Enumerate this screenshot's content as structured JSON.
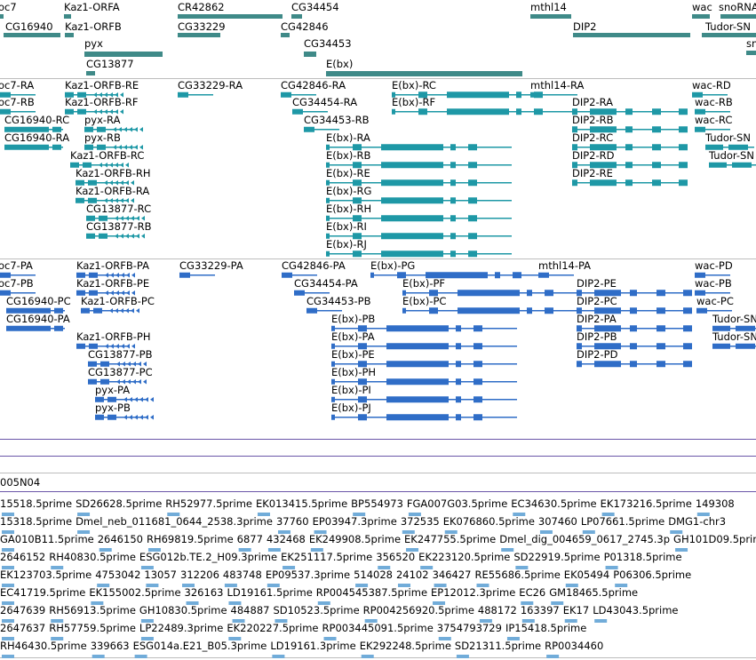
{
  "colors": {
    "rna": "#1e98a6",
    "cds": "#2f6dc7",
    "ncrna": "#3f8a88",
    "est": "#71acd9"
  },
  "bac": {
    "label": "005N04"
  },
  "gene_track": [
    {
      "label": "oc7",
      "line": "",
      "color": "ncrna"
    },
    {
      "label": "Kaz1-ORFA",
      "line": "",
      "color": "ncrna"
    },
    {
      "label": "CR42862",
      "line": "",
      "color": "ncrna"
    },
    {
      "label": "CG34454",
      "line": "",
      "color": "ncrna"
    },
    {
      "label": "mthl14",
      "line": "",
      "color": "ncrna"
    },
    {
      "label": "wac",
      "line": "",
      "color": "ncrna"
    },
    {
      "label": "snoRNA",
      "line": "",
      "color": "ncrna"
    },
    {
      "label": "CG16940",
      "line": "",
      "color": "ncrna"
    },
    {
      "label": "Kaz1-ORFB",
      "line": "",
      "color": "ncrna"
    },
    {
      "label": "CG33229",
      "line": "",
      "color": "ncrna"
    },
    {
      "label": "CG42846",
      "line": "",
      "color": "ncrna"
    },
    {
      "label": "DIP2",
      "line": "",
      "color": "ncrna"
    },
    {
      "label": "Tudor-SN",
      "line": "",
      "color": "ncrna"
    },
    {
      "label": "pyx",
      "line": "",
      "color": "ncrna"
    },
    {
      "label": "CG34453",
      "line": "",
      "color": "ncrna"
    },
    {
      "label": "sn",
      "line": "",
      "color": "ncrna"
    },
    {
      "label": "CG13877",
      "line": "",
      "color": "ncrna"
    },
    {
      "label": "E(bx)",
      "line": "",
      "color": "ncrna"
    }
  ],
  "transcript_track": [
    {
      "label": "oc7-RA",
      "color": "rna"
    },
    {
      "label": "Kaz1-ORFB-RE",
      "color": "rna"
    },
    {
      "label": "CG33229-RA",
      "color": "rna"
    },
    {
      "label": "CG42846-RA",
      "color": "rna"
    },
    {
      "label": "E(bx)-RC",
      "color": "rna"
    },
    {
      "label": "mthl14-RA",
      "color": "rna"
    },
    {
      "label": "wac-RD",
      "color": "rna"
    },
    {
      "label": "oc7-RB",
      "color": "rna"
    },
    {
      "label": "Kaz1-ORFB-RF",
      "color": "rna"
    },
    {
      "label": "CG34454-RA",
      "color": "rna"
    },
    {
      "label": "E(bx)-RF",
      "color": "rna"
    },
    {
      "label": "DIP2-RA",
      "color": "rna"
    },
    {
      "label": "wac-RB",
      "color": "rna"
    },
    {
      "label": "CG16940-RC",
      "color": "rna"
    },
    {
      "label": "pyx-RA",
      "color": "rna"
    },
    {
      "label": "CG34453-RB",
      "color": "rna"
    },
    {
      "label": "DIP2-RB",
      "color": "rna"
    },
    {
      "label": "wac-RC",
      "color": "rna"
    },
    {
      "label": "CG16940-RA",
      "color": "rna"
    },
    {
      "label": "pyx-RB",
      "color": "rna"
    },
    {
      "label": "E(bx)-RA",
      "color": "rna"
    },
    {
      "label": "DIP2-RC",
      "color": "rna"
    },
    {
      "label": "Tudor-SN",
      "color": "rna"
    },
    {
      "label": "Kaz1-ORFB-RC",
      "color": "rna"
    },
    {
      "label": "E(bx)-RB",
      "color": "rna"
    },
    {
      "label": "DIP2-RD",
      "color": "rna"
    },
    {
      "label": "Tudor-SN",
      "color": "rna"
    },
    {
      "label": "Kaz1-ORFB-RH",
      "color": "rna"
    },
    {
      "label": "E(bx)-RE",
      "color": "rna"
    },
    {
      "label": "DIP2-RE",
      "color": "rna"
    },
    {
      "label": "Kaz1-ORFB-RA",
      "color": "rna"
    },
    {
      "label": "E(bx)-RG",
      "color": "rna"
    },
    {
      "label": "CG13877-RC",
      "color": "rna"
    },
    {
      "label": "E(bx)-RH",
      "color": "rna"
    },
    {
      "label": "CG13877-RB",
      "color": "rna"
    },
    {
      "label": "E(bx)-RI",
      "color": "rna"
    },
    {
      "label": "E(bx)-RJ",
      "color": "rna"
    }
  ],
  "protein_track": [
    {
      "label": "oc7-PA",
      "color": "cds"
    },
    {
      "label": "Kaz1-ORFB-PA",
      "color": "cds"
    },
    {
      "label": "CG33229-PA",
      "color": "cds"
    },
    {
      "label": "CG42846-PA",
      "color": "cds"
    },
    {
      "label": "E(bx)-PG",
      "color": "cds"
    },
    {
      "label": "mthl14-PA",
      "color": "cds"
    },
    {
      "label": "wac-PD",
      "color": "cds"
    },
    {
      "label": "oc7-PB",
      "color": "cds"
    },
    {
      "label": "Kaz1-ORFB-PE",
      "color": "cds"
    },
    {
      "label": "CG34454-PA",
      "color": "cds"
    },
    {
      "label": "E(bx)-PF",
      "color": "cds"
    },
    {
      "label": "DIP2-PE",
      "color": "cds"
    },
    {
      "label": "wac-PB",
      "color": "cds"
    },
    {
      "label": "CG16940-PC",
      "color": "cds"
    },
    {
      "label": "Kaz1-ORFB-PC",
      "color": "cds"
    },
    {
      "label": "CG34453-PB",
      "color": "cds"
    },
    {
      "label": "E(bx)-PC",
      "color": "cds"
    },
    {
      "label": "DIP2-PC",
      "color": "cds"
    },
    {
      "label": "wac-PC",
      "color": "cds"
    },
    {
      "label": "CG16940-PA",
      "color": "cds"
    },
    {
      "label": "E(bx)-PB",
      "color": "cds"
    },
    {
      "label": "DIP2-PA",
      "color": "cds"
    },
    {
      "label": "Tudor-SN",
      "color": "cds"
    },
    {
      "label": "Kaz1-ORFB-PH",
      "color": "cds"
    },
    {
      "label": "E(bx)-PA",
      "color": "cds"
    },
    {
      "label": "DIP2-PB",
      "color": "cds"
    },
    {
      "label": "Tudor-SN",
      "color": "cds"
    },
    {
      "label": "CG13877-PB",
      "color": "cds"
    },
    {
      "label": "E(bx)-PE",
      "color": "cds"
    },
    {
      "label": "DIP2-PD",
      "color": "cds"
    },
    {
      "label": "CG13877-PC",
      "color": "cds"
    },
    {
      "label": "E(bx)-PH",
      "color": "cds"
    },
    {
      "label": "pyx-PA",
      "color": "cds"
    },
    {
      "label": "E(bx)-PI",
      "color": "cds"
    },
    {
      "label": "pyx-PB",
      "color": "cds"
    },
    {
      "label": "E(bx)-PJ",
      "color": "cds"
    }
  ],
  "est_labels": [
    "15518.5prime",
    "SD26628.5prime",
    "RH52977.5prime",
    "EK013415.5prime",
    "BP554973",
    "FGA007G03.5prime",
    "EC34630.5prime",
    "EK173216.5prime",
    "149308",
    "15318.5prime",
    "Dmel_neb_011681_0644_2538.3prime",
    "37760",
    "EP03947.3prime",
    "372535",
    "EK076860.5prime",
    "307460",
    "LP07661.5prime",
    "DMG1-chr3",
    "GA010B11.5prime",
    "2646150",
    "RH69819.5prime",
    "6877",
    "432468",
    "EK249908.5prime",
    "EK247755.5prime",
    "Dmel_dig_004659_0617_2745.3p",
    "GH101D09.5prime",
    "2646152",
    "RH40830.5prime",
    "ESG012b.TE.2_H09.3prime",
    "EK251117.5prime",
    "356520",
    "EK223120.5prime",
    "SD22919.5prime",
    "P01318.5prime",
    "EK123703.5prime",
    "4753042",
    "13057",
    "312206",
    "483748",
    "EP09537.3prime",
    "514028",
    "24102",
    "346427",
    "RE55686.5prime",
    "EK05494",
    "P06306.5prime",
    "EC41719.5prime",
    "EK155002.5prime",
    "326163",
    "LD19161.5prime",
    "RP004545387.5prime",
    "EP12012.3prime",
    "EC26",
    "GM18465.5prime",
    "2647639",
    "RH56913.5prime",
    "GH10830.5prime",
    "484887",
    "SD10523.5prime",
    "RP004256920.5prime",
    "488172",
    "163397",
    "EK17",
    "LD43043.5prime",
    "2647637",
    "RH57759.5prime",
    "LP22489.3prime",
    "EK220227.5prime",
    "RP003445091.5prime",
    "3754793729",
    "IP15418.5prime",
    "RH46430.5prime",
    "339663",
    "ESG014a.E21_B05.3prime",
    "LD19161.3prime",
    "EK292248.5prime",
    "SD21311.5prime",
    "RP0034460"
  ]
}
